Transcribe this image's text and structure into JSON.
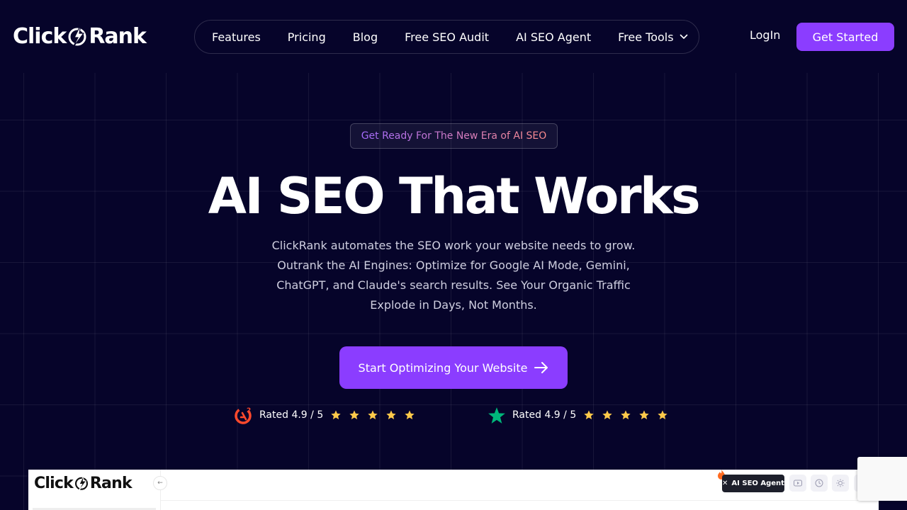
{
  "brand": {
    "logo_left": "Click",
    "logo_right": "Rank"
  },
  "nav": {
    "items": [
      {
        "label": "Features"
      },
      {
        "label": "Pricing"
      },
      {
        "label": "Blog"
      },
      {
        "label": "Free SEO Audit"
      },
      {
        "label": "AI SEO Agent"
      },
      {
        "label": "Free Tools"
      }
    ],
    "login": "LogIn",
    "get_started": "Get Started"
  },
  "hero": {
    "tagline": "Get Ready For The New Era of AI SEO",
    "title": "AI SEO That Works",
    "description": "ClickRank automates the SEO work your website needs to grow. Outrank the AI Engines: Optimize for Google AI Mode, Gemini, ChatGPT, and Claude's search results. See Your Organic Traffic Explode in Days, Not Months.",
    "cta": "Start Optimizing Your Website"
  },
  "ratings": [
    {
      "platform_icon": "g2-icon",
      "text": "Rated 4.9 / 5",
      "stars": 5
    },
    {
      "platform_icon": "trustpilot-icon",
      "text": "Rated 4.9 / 5",
      "stars": 5
    }
  ],
  "preview": {
    "logo_left": "Click",
    "logo_right": "Rank",
    "collapse_glyph": "←",
    "agent_button": "AI SEO Agent",
    "agent_close_glyph": "✕"
  },
  "colors": {
    "background": "#06042a",
    "accent": "#8b3dff",
    "star": "#ffc94a",
    "g2": "#ff492c",
    "trustpilot": "#00b67a"
  }
}
